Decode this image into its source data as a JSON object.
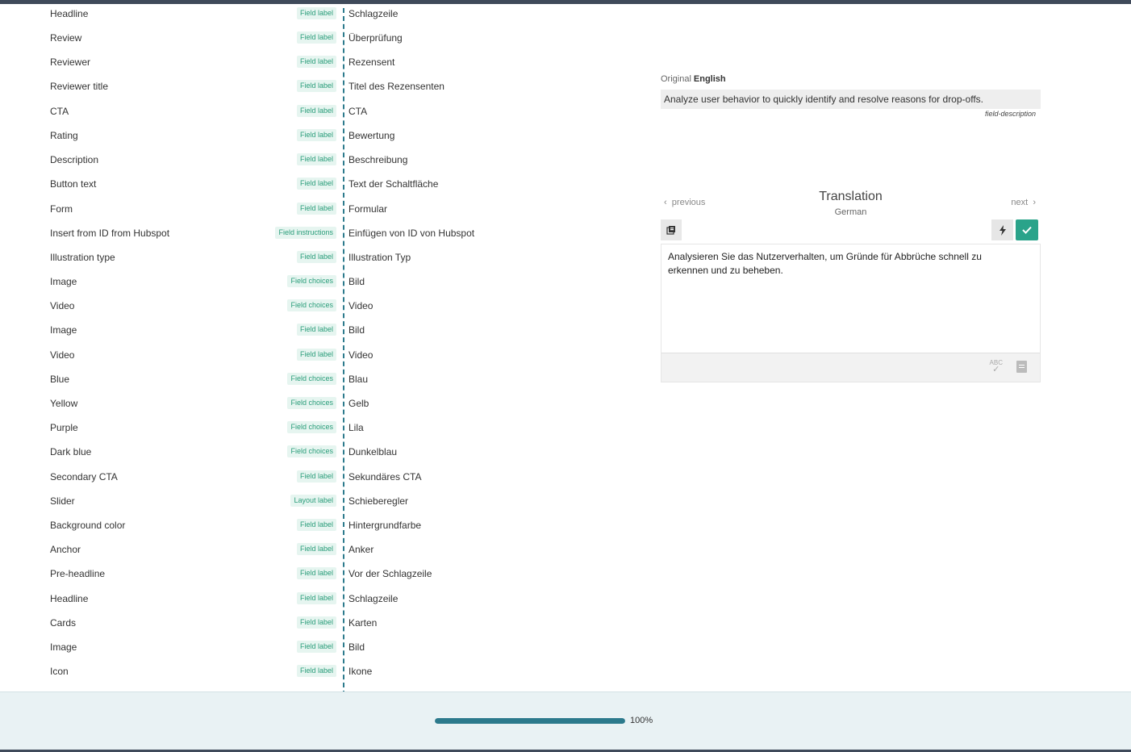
{
  "rows": [
    {
      "source": "Headline",
      "badge": "Field label",
      "target": "Schlagzeile"
    },
    {
      "source": "Review",
      "badge": "Field label",
      "target": "Überprüfung"
    },
    {
      "source": "Reviewer",
      "badge": "Field label",
      "target": "Rezensent"
    },
    {
      "source": "Reviewer title",
      "badge": "Field label",
      "target": "Titel des Rezensenten"
    },
    {
      "source": "CTA",
      "badge": "Field label",
      "target": "CTA"
    },
    {
      "source": "Rating",
      "badge": "Field label",
      "target": "Bewertung"
    },
    {
      "source": "Description",
      "badge": "Field label",
      "target": "Beschreibung"
    },
    {
      "source": "Button text",
      "badge": "Field label",
      "target": "Text der Schaltfläche"
    },
    {
      "source": "Form",
      "badge": "Field label",
      "target": "Formular"
    },
    {
      "source": "Insert from ID from Hubspot",
      "badge": "Field instructions",
      "target": "Einfügen von ID von Hubspot"
    },
    {
      "source": "Illustration type",
      "badge": "Field label",
      "target": "Illustration Typ"
    },
    {
      "source": "Image",
      "badge": "Field choices",
      "target": "Bild"
    },
    {
      "source": "Video",
      "badge": "Field choices",
      "target": "Video"
    },
    {
      "source": "Image",
      "badge": "Field label",
      "target": "Bild"
    },
    {
      "source": "Video",
      "badge": "Field label",
      "target": "Video"
    },
    {
      "source": "Blue",
      "badge": "Field choices",
      "target": "Blau"
    },
    {
      "source": "Yellow",
      "badge": "Field choices",
      "target": "Gelb"
    },
    {
      "source": "Purple",
      "badge": "Field choices",
      "target": "Lila"
    },
    {
      "source": "Dark blue",
      "badge": "Field choices",
      "target": "Dunkelblau"
    },
    {
      "source": "Secondary CTA",
      "badge": "Field label",
      "target": "Sekundäres CTA"
    },
    {
      "source": "Slider",
      "badge": "Layout label",
      "target": "Schieberegler"
    },
    {
      "source": "Background color",
      "badge": "Field label",
      "target": "Hintergrundfarbe"
    },
    {
      "source": "Anchor",
      "badge": "Field label",
      "target": "Anker"
    },
    {
      "source": "Pre-headline",
      "badge": "Field label",
      "target": "Vor der Schlagzeile"
    },
    {
      "source": "Headline",
      "badge": "Field label",
      "target": "Schlagzeile"
    },
    {
      "source": "Cards",
      "badge": "Field label",
      "target": "Karten"
    },
    {
      "source": "Image",
      "badge": "Field label",
      "target": "Bild"
    },
    {
      "source": "Icon",
      "badge": "Field label",
      "target": "Ikone"
    }
  ],
  "original": {
    "label": "Original",
    "language": "English",
    "text": "Analyze user behavior to quickly identify and resolve reasons for drop-offs.",
    "field_tag": "field-description"
  },
  "translation": {
    "title": "Translation",
    "language": "German",
    "prev_label": "previous",
    "next_label": "next",
    "text": "Analysieren Sie das Nutzerverhalten, um Gründe für Abbrüche schnell zu erkennen und zu beheben."
  },
  "icons": {
    "copy": "copy-source-icon",
    "machine_translate": "lightning-icon",
    "confirm": "check-icon",
    "spellcheck": "spellcheck-icon",
    "dictionary": "dictionary-icon"
  },
  "colors": {
    "accent": "#2c7a8c",
    "confirm": "#2aa38a",
    "badge_text": "#2a9d7a",
    "badge_bg": "#e6f5f0"
  },
  "progress": {
    "percent": 100,
    "label": "100%"
  }
}
